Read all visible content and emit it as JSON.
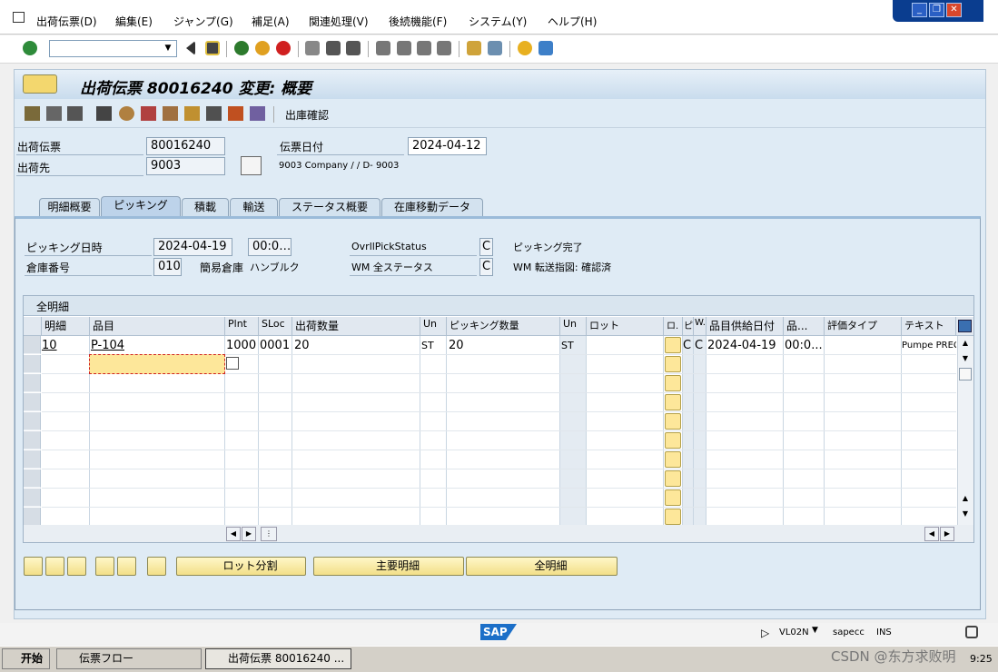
{
  "menu": [
    "出荷伝票(D)",
    "編集(E)",
    "ジャンプ(G)",
    "補足(A)",
    "関連処理(V)",
    "後続機能(F)",
    "システム(Y)",
    "ヘルプ(H)"
  ],
  "window_controls": {
    "minimize": "_",
    "restore": "❐",
    "close": "✕"
  },
  "title": "出荷伝票 80016240 変更: 概要",
  "app_toolbar": {
    "goods_issue_label": "出庫確認"
  },
  "header": {
    "delivery_label": "出荷伝票",
    "delivery_value": "80016240",
    "shipto_label": "出荷先",
    "shipto_value": "9003",
    "docdate_label": "伝票日付",
    "docdate_value": "2024-04-12",
    "shipto_address": "9003 Company / / D- 9003"
  },
  "tabs": [
    "明細概要",
    "ピッキング",
    "積載",
    "輸送",
    "ステータス概要",
    "在庫移動データ"
  ],
  "active_tab": 1,
  "picking": {
    "pickdate_label": "ピッキング日時",
    "pickdate_value": "2024-04-19",
    "picktime_value": "00:0…",
    "overall_label": "OvrllPickStatus",
    "overall_value": "C",
    "overall_text": "ピッキング完了",
    "warehouse_label": "倉庫番号",
    "warehouse_value": "010",
    "warehouse_text_label": "簡易倉庫",
    "warehouse_text": "ハンブルク",
    "wm_label": "WM 全ステータス",
    "wm_value": "C",
    "wm_text": "WM 転送指図: 確認済"
  },
  "table": {
    "caption": "全明細",
    "columns": [
      "明細",
      "品目",
      "Plnt",
      "SLoc",
      "出荷数量",
      "Un",
      "ピッキング数量",
      "Un",
      "ロット",
      "ロ.",
      "ピ",
      "W.",
      "品目供給日付",
      "品...",
      "評価タイプ",
      "テキスト"
    ],
    "rows": [
      [
        "10",
        "P-104",
        "1000",
        "0001",
        "20",
        "ST",
        "20",
        "ST",
        "",
        "",
        "C",
        "C",
        "2024-04-19",
        "00:0...",
        "",
        "Pumpe PREC"
      ]
    ]
  },
  "bottom_buttons": {
    "batch_split": "ロット分割",
    "main_items": "主要明細",
    "all_items": "全明細"
  },
  "status": {
    "tcode": "VL02N",
    "server": "sapecc",
    "mode": "INS",
    "sap_logo": "SAP"
  },
  "taskbar": {
    "start": "开始",
    "task1": "伝票フロー",
    "task2": "出荷伝票 80016240 ...",
    "clock": "9:25",
    "watermark": "CSDN @东方求败明"
  }
}
